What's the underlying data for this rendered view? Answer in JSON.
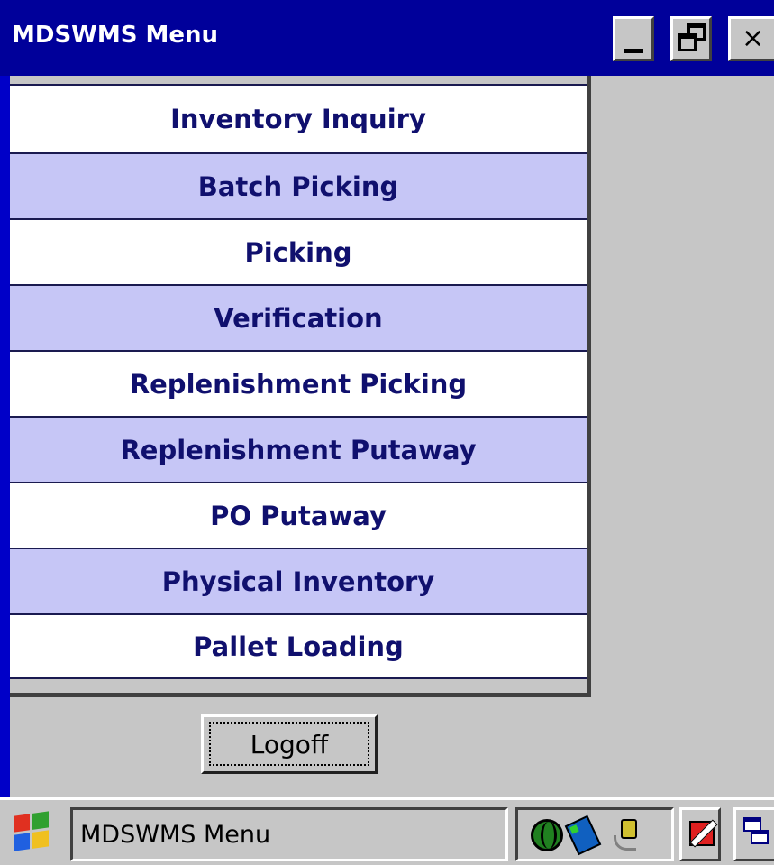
{
  "window": {
    "title": "MDSWMS Menu",
    "controls": {
      "minimize": "minimize-icon",
      "maximize": "restore-icon",
      "close": "×"
    }
  },
  "menu": {
    "items": [
      {
        "label": "Inventory Inquiry"
      },
      {
        "label": "Batch Picking"
      },
      {
        "label": "Picking"
      },
      {
        "label": "Verification"
      },
      {
        "label": "Replenishment Picking"
      },
      {
        "label": "Replenishment Putaway"
      },
      {
        "label": "PO Putaway"
      },
      {
        "label": "Physical Inventory"
      },
      {
        "label": "Pallet Loading"
      }
    ],
    "colors": {
      "even": "#ffffff",
      "odd": "#c6c6f6",
      "text": "#10106e"
    }
  },
  "logoff": {
    "label": "Logoff"
  },
  "taskbar": {
    "task_label": "MDSWMS Menu",
    "tray_icons": [
      "globe-icon",
      "network-icon",
      "power-plug-icon"
    ],
    "buttons": [
      "input-panel-icon",
      "desktop-icon"
    ]
  }
}
